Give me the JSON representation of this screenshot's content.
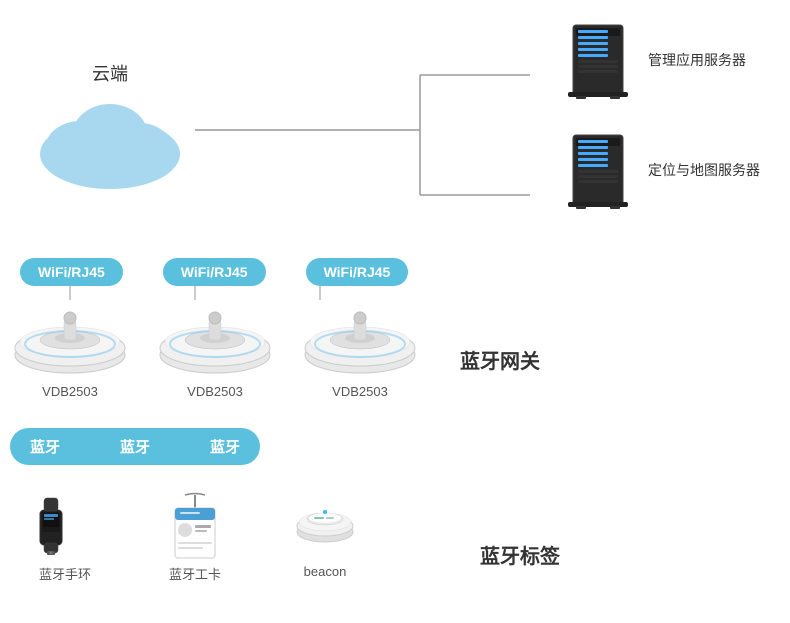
{
  "cloud": {
    "label": "云端"
  },
  "servers": [
    {
      "label": "管理应用服务器"
    },
    {
      "label": "定位与地图服务器"
    }
  ],
  "wifi_pills": [
    {
      "text": "WiFi/RJ45"
    },
    {
      "text": "WiFi/RJ45"
    },
    {
      "text": "WiFi/RJ45"
    }
  ],
  "gateways": [
    {
      "label": "VDB2503"
    },
    {
      "label": "VDB2503"
    },
    {
      "label": "VDB2503"
    }
  ],
  "gateway_title": "蓝牙网关",
  "bt_pills": [
    {
      "text": "蓝牙"
    },
    {
      "text": "蓝牙"
    },
    {
      "text": "蓝牙"
    }
  ],
  "tags": [
    {
      "label": "蓝牙手环"
    },
    {
      "label": "蓝牙工卡"
    },
    {
      "label": "beacon"
    }
  ],
  "bt_tag_title": "蓝牙标签"
}
